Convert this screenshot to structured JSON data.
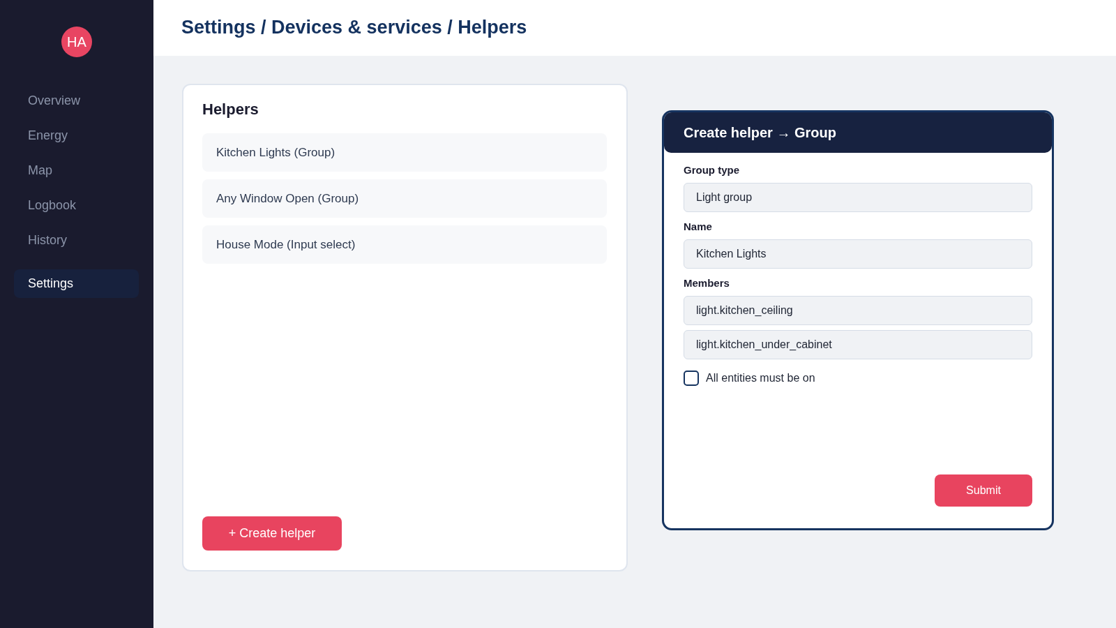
{
  "sidebar": {
    "logo": "HA",
    "items": [
      {
        "label": "Overview",
        "selected": false
      },
      {
        "label": "Energy",
        "selected": false
      },
      {
        "label": "Map",
        "selected": false
      },
      {
        "label": "Logbook",
        "selected": false
      },
      {
        "label": "History",
        "selected": false
      },
      {
        "label": "Settings",
        "selected": true
      }
    ]
  },
  "header": {
    "breadcrumb": "Settings / Devices & services / Helpers"
  },
  "helpers_panel": {
    "title": "Helpers",
    "items": [
      "Kitchen Lights (Group)",
      "Any Window Open (Group)",
      "House Mode (Input select)"
    ],
    "create_button": "+ Create helper"
  },
  "dialog": {
    "title": "Create helper → Group",
    "fields": [
      {
        "label": "Group type",
        "values": [
          "Light group"
        ]
      },
      {
        "label": "Name",
        "values": [
          "Kitchen Lights"
        ]
      },
      {
        "label": "Members",
        "values": [
          "light.kitchen_ceiling",
          "light.kitchen_under_cabinet"
        ]
      }
    ],
    "checkbox": {
      "label": "All entities must be on",
      "checked": false
    },
    "submit": "Submit"
  }
}
